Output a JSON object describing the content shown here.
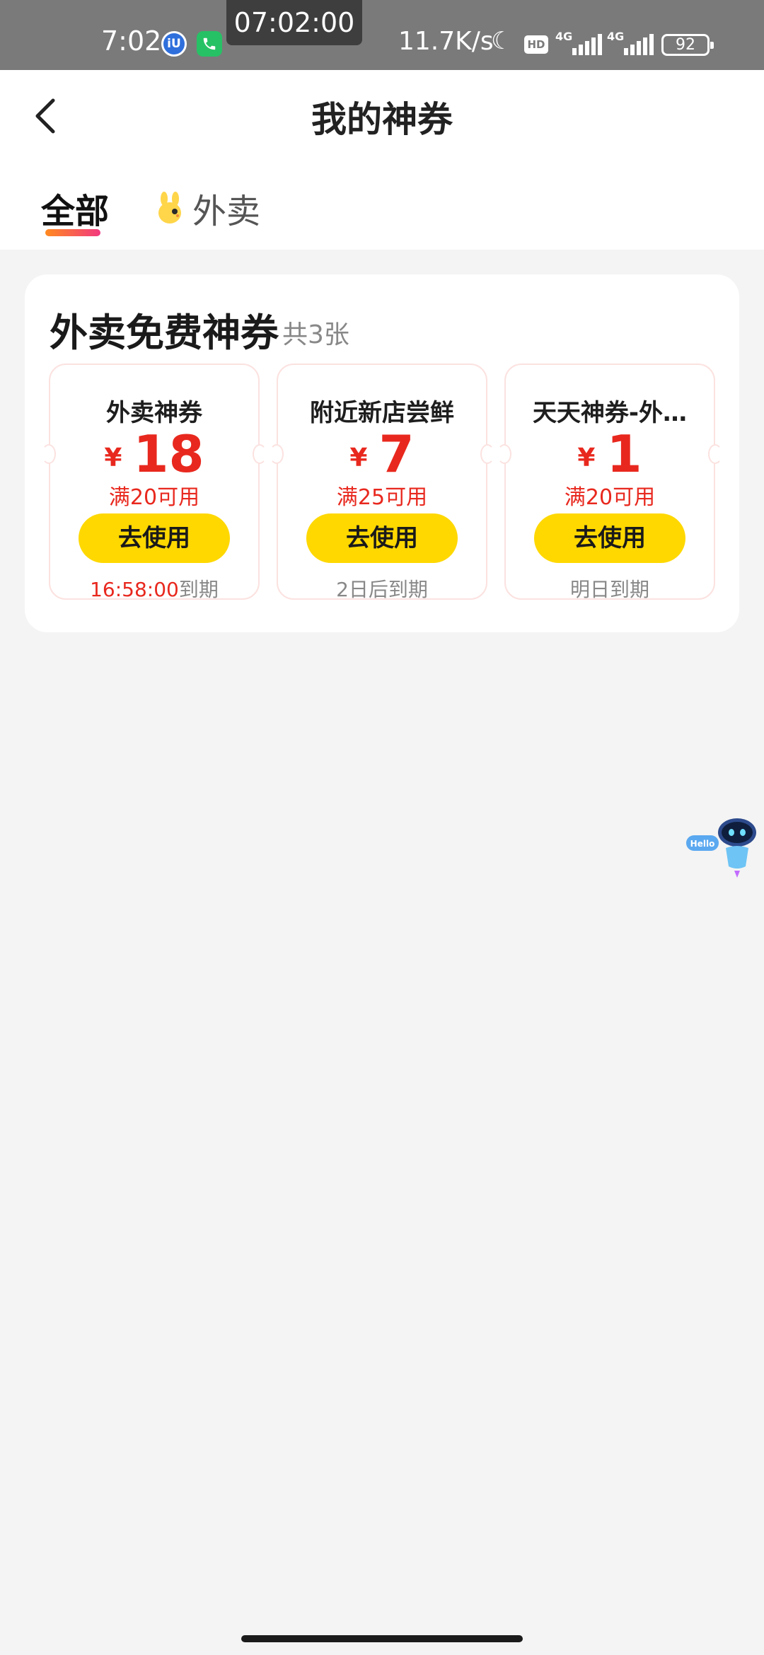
{
  "status_bar": {
    "time": "7:02",
    "app_icon_iu": "iU",
    "phone_icon": "phone-icon",
    "recording_timer": "07:02:00",
    "net_speed": "11.7K/s",
    "hd_label": "HD",
    "network_1": "4G",
    "network_2": "4G",
    "battery": "92"
  },
  "navbar": {
    "back_icon": "back-arrow-icon",
    "title": "我的神券"
  },
  "tabs": [
    {
      "label": "全部",
      "active": true
    },
    {
      "label": "外卖",
      "active": false,
      "icon": "mascot-icon"
    }
  ],
  "section": {
    "title": "外卖免费神券",
    "count": "共3张"
  },
  "coupons": [
    {
      "name": "外卖神券",
      "currency": "¥",
      "amount": "18",
      "condition": "满20可用",
      "button": "去使用",
      "expire_highlight": "16:58:00",
      "expire_suffix": "到期"
    },
    {
      "name": "附近新店尝鲜",
      "currency": "¥",
      "amount": "7",
      "condition": "满25可用",
      "button": "去使用",
      "expire_highlight": "",
      "expire_suffix": "2日后到期"
    },
    {
      "name": "天天神券-外…",
      "currency": "¥",
      "amount": "1",
      "condition": "满20可用",
      "button": "去使用",
      "expire_highlight": "",
      "expire_suffix": "明日到期"
    }
  ],
  "assistant": {
    "bubble": "Hello",
    "icon": "robot-assistant-icon"
  },
  "colors": {
    "accent_red": "#e8281e",
    "button_yellow": "#ffd800",
    "tab_gradient_start": "#ff8a1f",
    "tab_gradient_end": "#f2387f"
  }
}
